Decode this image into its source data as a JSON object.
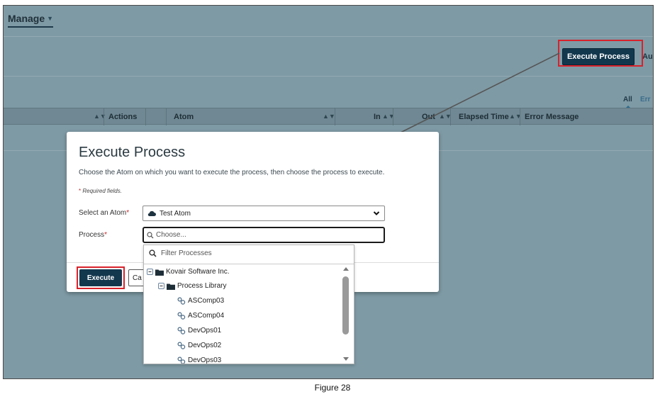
{
  "header": {
    "manage_label": "Manage"
  },
  "toolbar": {
    "execute_process_label": "Execute Process",
    "truncated_label": "Au"
  },
  "filters": {
    "all_label": "All",
    "errors_label": "Err"
  },
  "table": {
    "columns": [
      "Actions",
      "Atom",
      "In",
      "Out",
      "Elapsed Time",
      "Error Message"
    ]
  },
  "modal": {
    "title": "Execute Process",
    "description": "Choose the Atom on which you want to execute the process, then choose the process to execute.",
    "required_star": "*",
    "required_note": "Required fields.",
    "atom_label": "Select an Atom",
    "atom_value": "Test Atom",
    "process_label": "Process",
    "process_placeholder": "Choose...",
    "execute_label": "Execute",
    "cancel_label": "Ca"
  },
  "dropdown": {
    "filter_placeholder": "Filter Processes",
    "tree": {
      "root": "Kovair Software Inc.",
      "folder": "Process Library",
      "processes": [
        "ASComp03",
        "ASComp04",
        "DevOps01",
        "DevOps02",
        "DevOps03"
      ]
    }
  },
  "caption": "Figure 28",
  "colors": {
    "accent": "#12384e",
    "highlight": "#d8222b",
    "backdrop": "#7e9aa5"
  },
  "icons": [
    "caret-down-icon",
    "sort-icon",
    "cloud-icon",
    "chevron-down-icon",
    "search-icon",
    "collapse-icon",
    "folder-icon",
    "process-icon"
  ]
}
